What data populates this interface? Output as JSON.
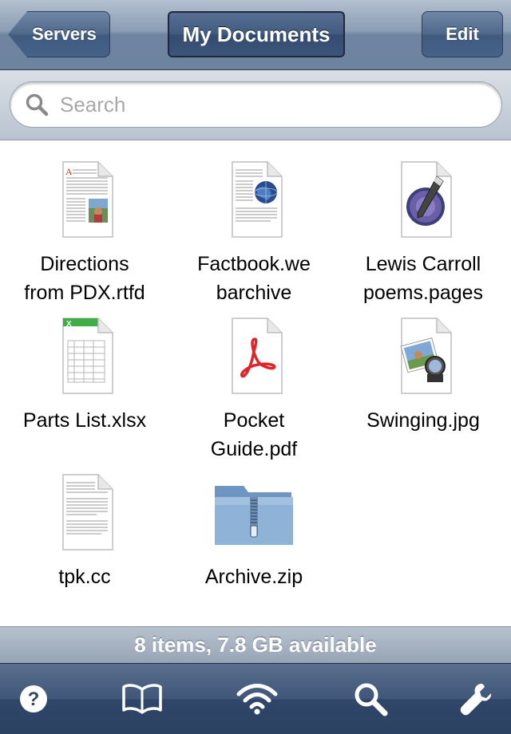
{
  "nav": {
    "back_label": "Servers",
    "title": "My Documents",
    "edit_label": "Edit"
  },
  "search": {
    "placeholder": "Search",
    "value": ""
  },
  "files": [
    {
      "name": "Directions\nfrom PDX.rtfd",
      "icon": "rtfd-document-icon"
    },
    {
      "name": "Factbook.we\nbarchive",
      "icon": "webarchive-document-icon"
    },
    {
      "name": "Lewis Carroll\npoems.pages",
      "icon": "pages-document-icon"
    },
    {
      "name": "Parts List.xlsx",
      "icon": "xlsx-spreadsheet-icon"
    },
    {
      "name": "Pocket\nGuide.pdf",
      "icon": "pdf-document-icon"
    },
    {
      "name": "Swinging.jpg",
      "icon": "jpg-image-icon"
    },
    {
      "name": "tpk.cc",
      "icon": "text-document-icon"
    },
    {
      "name": "Archive.zip",
      "icon": "zip-folder-icon"
    }
  ],
  "status": {
    "text": "8 items, 7.8 GB available"
  },
  "toolbar": {
    "items": [
      "help-icon",
      "book-icon",
      "wifi-icon",
      "search-icon",
      "wrench-icon"
    ]
  },
  "colors": {
    "nav_bar": "#6d84a1",
    "toolbar": "#2f4669",
    "status_bar": "#a8b3c1",
    "zip_folder": "#8fb3d6",
    "pdf_red": "#e0242a",
    "xlsx_green": "#3fae49"
  }
}
